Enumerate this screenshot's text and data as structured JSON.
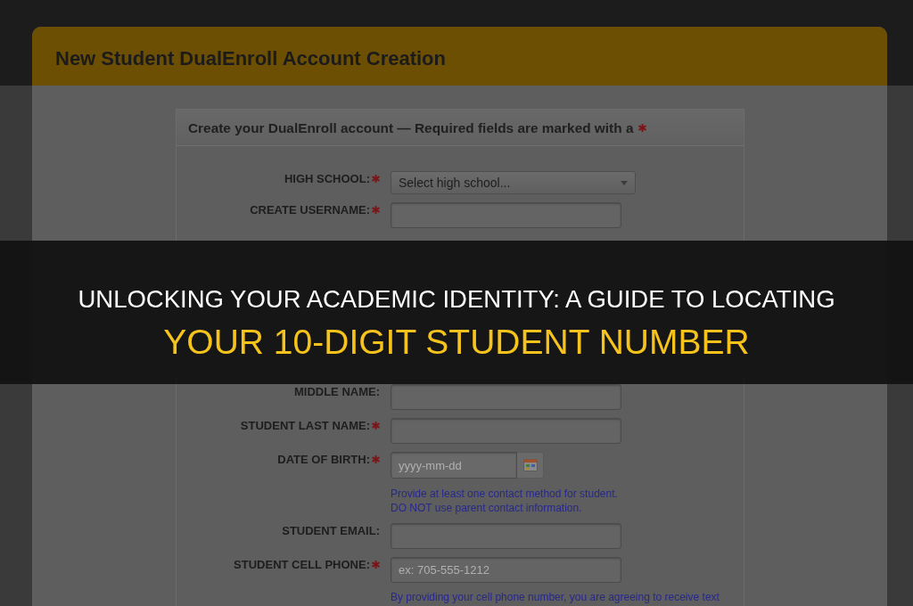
{
  "page_header": {
    "title": "New Student DualEnroll Account Creation"
  },
  "form_panel": {
    "heading": "Create your DualEnroll account — Required fields are marked with a",
    "upper_fields": [
      {
        "kind": "select",
        "label": "HIGH SCHOOL:",
        "required": true,
        "value": "Select high school..."
      },
      {
        "kind": "text",
        "label": "CREATE USERNAME:",
        "required": true
      }
    ],
    "lower_fields": [
      {
        "kind": "text",
        "label": "MIDDLE NAME:",
        "required": false
      },
      {
        "kind": "text",
        "label": "STUDENT LAST NAME:",
        "required": true
      },
      {
        "kind": "date",
        "label": "DATE OF BIRTH:",
        "required": true,
        "placeholder": "yyyy-mm-dd"
      },
      {
        "kind": "hint",
        "lines": [
          "Provide at least one contact method for student.",
          "DO NOT use parent contact information."
        ]
      },
      {
        "kind": "text",
        "label": "STUDENT EMAIL:",
        "required": false
      },
      {
        "kind": "text",
        "label": "STUDENT CELL PHONE:",
        "required": true,
        "placeholder": "ex: 705-555-1212"
      },
      {
        "kind": "hint",
        "lines": [
          "By providing your cell phone number, you are agreeing to receive text"
        ]
      }
    ]
  },
  "banner": {
    "title": "UNLOCKING YOUR ACADEMIC IDENTITY: A GUIDE TO LOCATING",
    "highlight": "YOUR 10-DIGIT STUDENT NUMBER"
  }
}
